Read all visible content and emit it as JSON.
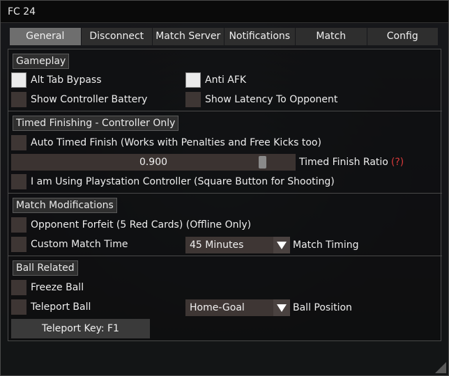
{
  "window": {
    "title": "FC 24"
  },
  "tabs": [
    {
      "label": "General",
      "active": true
    },
    {
      "label": "Disconnect",
      "active": false
    },
    {
      "label": "Match Server",
      "active": false
    },
    {
      "label": "Notifications",
      "active": false
    },
    {
      "label": "Match",
      "active": false
    },
    {
      "label": "Config",
      "active": false
    }
  ],
  "gameplay": {
    "header": "Gameplay",
    "alt_tab_bypass": {
      "label": "Alt Tab Bypass",
      "checked": true
    },
    "anti_afk": {
      "label": "Anti AFK",
      "checked": true
    },
    "show_controller_battery": {
      "label": "Show Controller Battery",
      "checked": false
    },
    "show_latency": {
      "label": "Show Latency To Opponent",
      "checked": false
    }
  },
  "timed_finishing": {
    "header": "Timed Finishing - Controller Only",
    "auto_timed_finish": {
      "label": "Auto Timed Finish (Works with Penalties and Free Kicks too)",
      "checked": false
    },
    "ratio": {
      "value": 0.9,
      "value_text": "0.900",
      "label": "Timed Finish Ratio",
      "help": "(?)"
    },
    "playstation": {
      "label": "I am Using Playstation Controller (Square Button for Shooting)",
      "checked": false
    }
  },
  "match_modifications": {
    "header": "Match Modifications",
    "opponent_forfeit": {
      "label": "Opponent Forfeit (5 Red Cards) (Offline Only)",
      "checked": false
    },
    "custom_match_time": {
      "label": "Custom Match Time",
      "checked": false
    },
    "match_timing": {
      "selected": "45 Minutes",
      "label": "Match Timing"
    }
  },
  "ball_related": {
    "header": "Ball Related",
    "freeze_ball": {
      "label": "Freeze Ball",
      "checked": false
    },
    "teleport_ball": {
      "label": "Teleport Ball",
      "checked": false
    },
    "ball_position": {
      "selected": "Home-Goal",
      "label": "Ball Position"
    },
    "teleport_key": "Teleport Key: F1"
  },
  "colors": {
    "active_tab": "#6e6e6e",
    "inactive_tab": "#2e2e2e",
    "checkbox_off": "#3e3634",
    "checkbox_on": "#ebebeb",
    "help_red": "#d83a3a"
  }
}
